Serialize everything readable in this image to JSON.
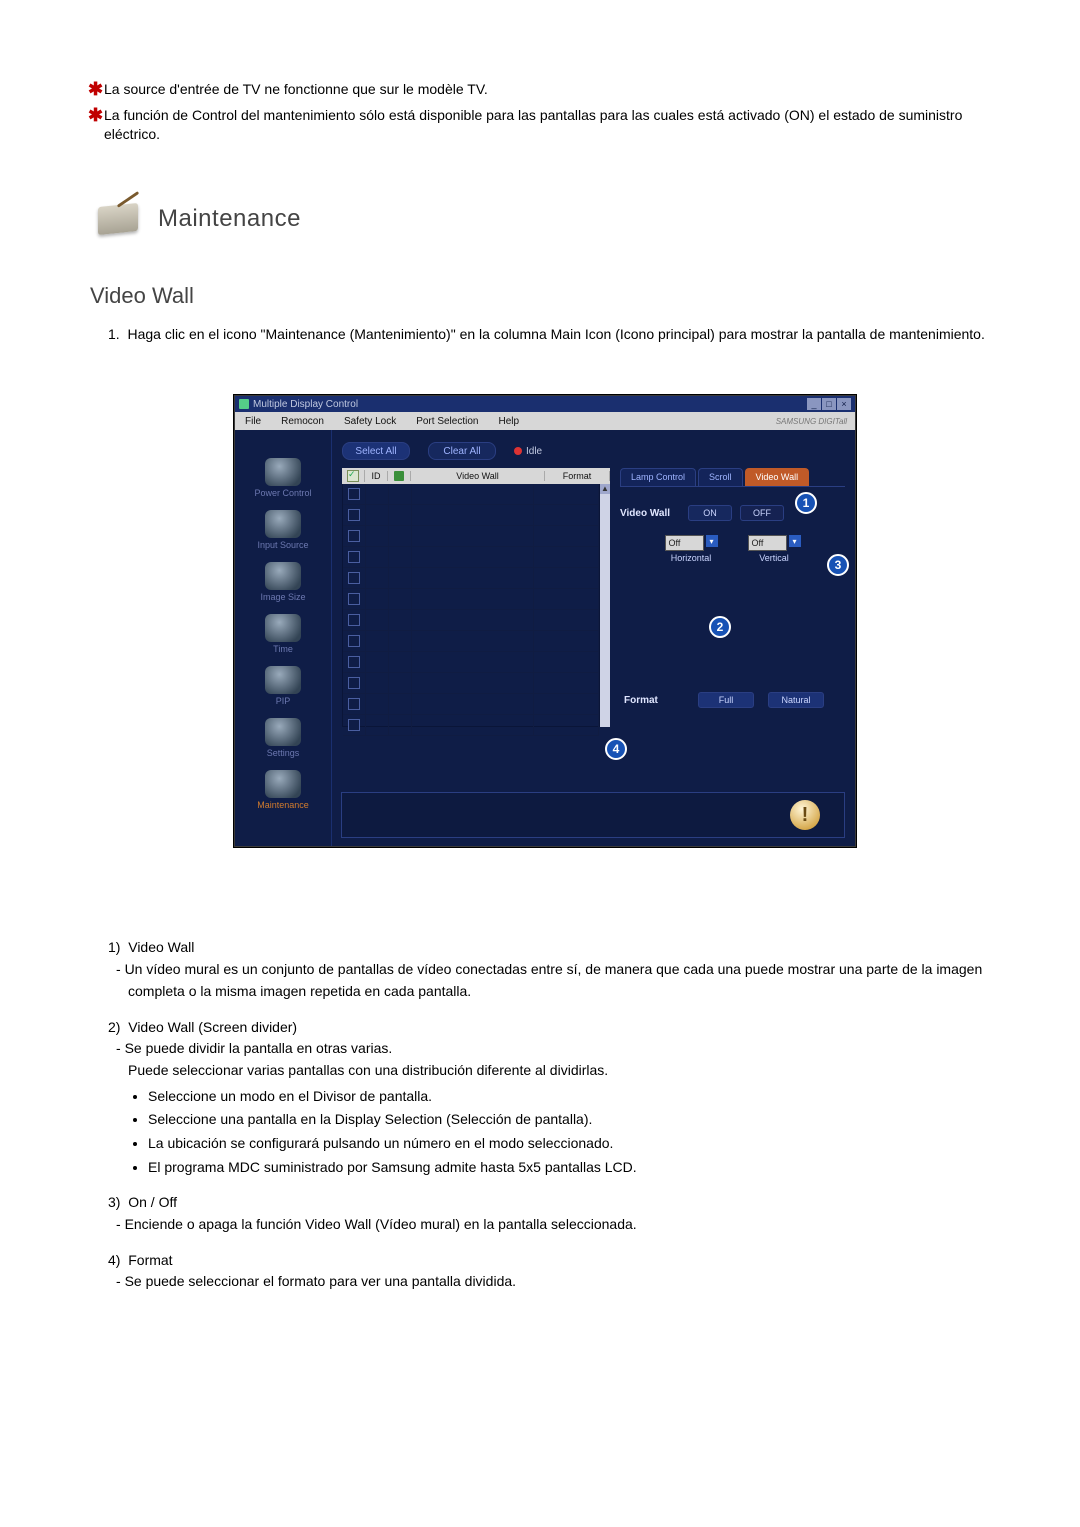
{
  "notes": {
    "n1": "La source d'entrée de TV ne fonctionne que sur le modèle TV.",
    "n2": "La función de Control del mantenimiento sólo está disponible para las pantallas para las cuales está activado (ON) el estado de suministro eléctrico."
  },
  "maintenance": {
    "title": "Maintenance"
  },
  "section": {
    "title": "Video Wall"
  },
  "step1": "Haga clic en el icono \"Maintenance (Mantenimiento)\" en la columna Main Icon (Icono principal) para mostrar la pantalla de mantenimiento.",
  "app": {
    "window_title": "Multiple Display Control",
    "brand": "SAMSUNG DIGITall",
    "menus": [
      "File",
      "Remocon",
      "Safety Lock",
      "Port Selection",
      "Help"
    ],
    "sidebar": [
      {
        "label": "Power Control"
      },
      {
        "label": "Input Source"
      },
      {
        "label": "Image Size"
      },
      {
        "label": "Time"
      },
      {
        "label": "PIP"
      },
      {
        "label": "Settings"
      },
      {
        "label": "Maintenance"
      }
    ],
    "toolbar": {
      "select_all": "Select All",
      "clear_all": "Clear All",
      "idle": "Idle"
    },
    "table": {
      "headers": {
        "chk": "",
        "id": "ID",
        "icon": "",
        "video_wall": "Video Wall",
        "format": "Format"
      },
      "row_count": 12
    },
    "tabs": {
      "lamp": "Lamp Control",
      "scroll": "Scroll",
      "video_wall": "Video Wall"
    },
    "video_wall_panel": {
      "label": "Video Wall",
      "on": "ON",
      "off": "OFF",
      "horizontal_label": "Horizontal",
      "vertical_label": "Vertical",
      "h_value": "Off",
      "v_value": "Off"
    },
    "format_panel": {
      "label": "Format",
      "full": "Full",
      "natural": "Natural"
    },
    "callouts": {
      "c1": "1",
      "c2": "2",
      "c3": "3",
      "c4": "4"
    }
  },
  "desc": {
    "i1": {
      "title": "Video Wall",
      "d1": "Un vídeo mural es un conjunto de pantallas de vídeo conectadas entre sí, de manera que cada una puede mostrar una parte de la imagen completa o la misma imagen repetida en cada pantalla."
    },
    "i2": {
      "title": "Video Wall (Screen divider)",
      "d1": "Se puede dividir la pantalla en otras varias.",
      "d2": "Puede seleccionar varias pantallas con una distribución diferente al dividirlas.",
      "b1": "Seleccione un modo en el Divisor de pantalla.",
      "b2": "Seleccione una pantalla en la Display Selection (Selección de pantalla).",
      "b3": "La ubicación se configurará pulsando un número en el modo seleccionado.",
      "b4": "El programa MDC suministrado por Samsung admite hasta 5x5 pantallas LCD."
    },
    "i3": {
      "title": "On / Off",
      "d1": "Enciende o apaga la función Video Wall (Vídeo mural) en la pantalla seleccionada."
    },
    "i4": {
      "title": "Format",
      "d1": "Se puede seleccionar el formato para ver una pantalla dividida."
    }
  }
}
